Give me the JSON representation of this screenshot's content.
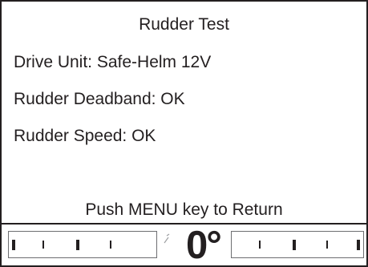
{
  "screen": {
    "title": "Rudder Test",
    "drive_unit": "Drive Unit: Safe-Helm 12V",
    "deadband": "Rudder Deadband: OK",
    "speed": "Rudder Speed: OK",
    "footer": "Push MENU key to Return"
  },
  "rudder_indicator": {
    "angle_label": "0°",
    "angle_value_deg": 0,
    "pointer_icon": "rudder-pointer-icon"
  },
  "colors": {
    "text": "#231f20",
    "scale_border": "#6d6e71",
    "background": "#ffffff"
  }
}
